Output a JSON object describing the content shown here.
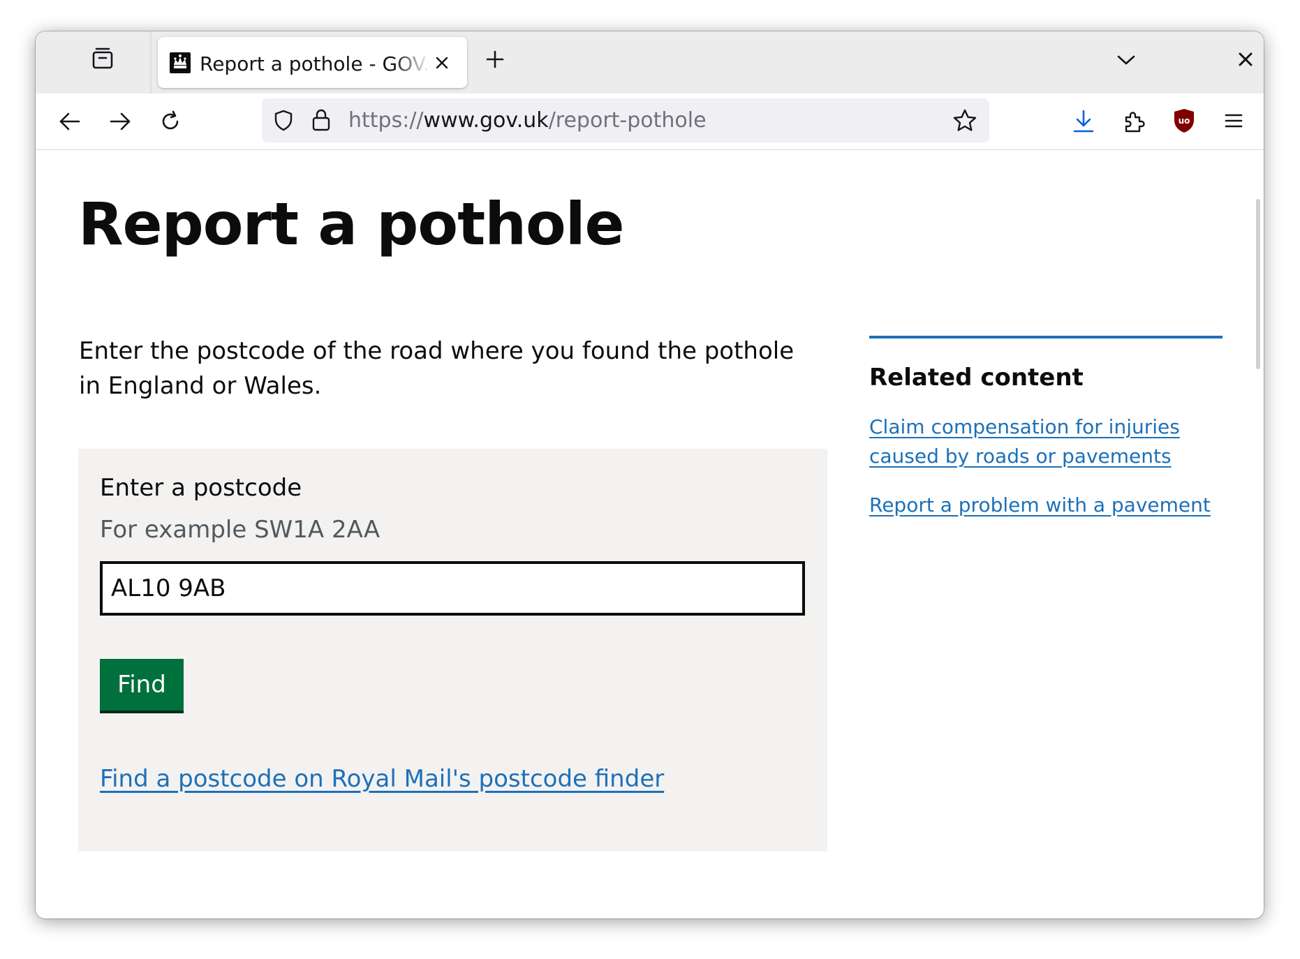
{
  "browser": {
    "tab": {
      "title": "Report a pothole - GOV.UK",
      "favicon": "crown-icon"
    },
    "address_bar": {
      "scheme": "https://",
      "host": "www.gov.uk",
      "path": "/report-pothole"
    },
    "icons": {
      "tab_overview": "tab-overview-icon",
      "new_tab": "plus-icon",
      "list_all_tabs": "chevron-down-icon",
      "close_window": "close-icon",
      "back": "back-arrow-icon",
      "forward": "forward-arrow-icon",
      "reload": "reload-icon",
      "tracking_protection": "shield-icon",
      "site_security": "lock-icon",
      "bookmark": "star-icon",
      "downloads": "download-icon",
      "extensions": "puzzle-icon",
      "ublock": "ublock-origin-icon",
      "menu": "hamburger-menu-icon"
    }
  },
  "page": {
    "title": "Report a pothole",
    "intro": "Enter the postcode of the road where you found the pothole in England or Wales.",
    "form": {
      "label": "Enter a postcode",
      "hint": "For example SW1A 2AA",
      "value": "AL10 9AB",
      "button": "Find",
      "link": "Find a postcode on Royal Mail's postcode finder"
    },
    "related": {
      "heading": "Related content",
      "links": [
        "Claim compensation for injuries caused by roads or pavements",
        "Report a problem with a pavement"
      ]
    }
  },
  "colors": {
    "link": "#1d70b8",
    "button": "#00703c",
    "button_shadow": "#002d18",
    "panel": "#f3f2f1",
    "text": "#0b0c0c",
    "hint": "#505a5f",
    "download_icon": "#0060df",
    "ublock": "#800000"
  }
}
